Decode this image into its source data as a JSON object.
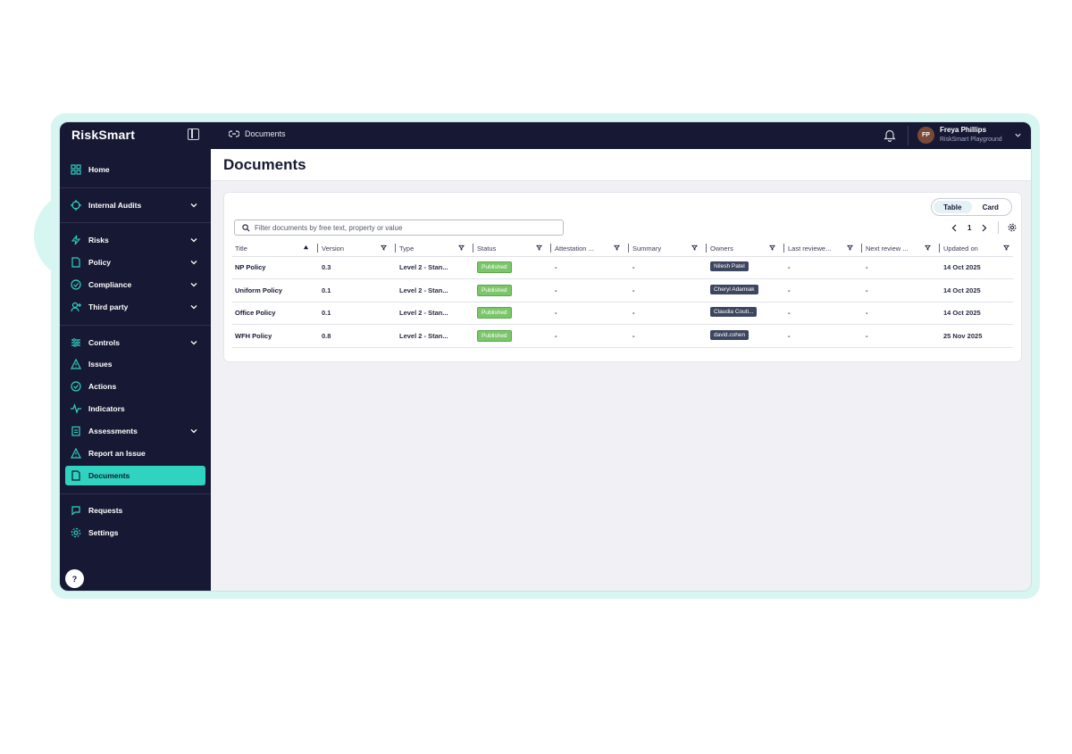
{
  "app": {
    "brand": "RiskSmart"
  },
  "breadcrumb": {
    "label": "Documents"
  },
  "user": {
    "initials": "FP",
    "name": "Freya Phillips",
    "org": "RiskSmart Playground"
  },
  "sidebar": {
    "items": [
      {
        "label": "Home",
        "icon": "grid-icon"
      },
      {
        "label": "Internal Audits",
        "icon": "audit-icon",
        "expandable": true
      },
      {
        "label": "Risks",
        "icon": "bolt-icon",
        "expandable": true
      },
      {
        "label": "Policy",
        "icon": "document-icon",
        "expandable": true
      },
      {
        "label": "Compliance",
        "icon": "check-circle-icon",
        "expandable": true
      },
      {
        "label": "Third party",
        "icon": "user-plus-icon",
        "expandable": true
      },
      {
        "label": "Controls",
        "icon": "sliders-icon",
        "expandable": true
      },
      {
        "label": "Issues",
        "icon": "warning-icon"
      },
      {
        "label": "Actions",
        "icon": "check-circle-icon"
      },
      {
        "label": "Indicators",
        "icon": "pulse-icon"
      },
      {
        "label": "Assessments",
        "icon": "clipboard-icon",
        "expandable": true
      },
      {
        "label": "Report an Issue",
        "icon": "warning-icon"
      },
      {
        "label": "Documents",
        "icon": "document-icon",
        "active": true
      },
      {
        "label": "Requests",
        "icon": "chat-icon"
      },
      {
        "label": "Settings",
        "icon": "gear-icon"
      }
    ],
    "help_label": "?"
  },
  "main": {
    "title": "Documents",
    "view_toggle": {
      "table": "Table",
      "card": "Card",
      "selected": "Table"
    },
    "search": {
      "placeholder": "Filter documents by free text, property or value"
    },
    "pager": {
      "page": "1"
    },
    "columns": [
      "Title",
      "Version",
      "Type",
      "Status",
      "Attestation ...",
      "Summary",
      "Owners",
      "Last reviewe...",
      "Next review ...",
      "Updated on"
    ],
    "rows": [
      {
        "title": "NP Policy",
        "version": "0.3",
        "type": "Level 2 - Stan...",
        "status": "Published",
        "attestation": "-",
        "summary": "-",
        "owner": "Nilesh Patel",
        "last_review": "-",
        "next_review": "-",
        "updated": "14 Oct 2025"
      },
      {
        "title": "Uniform Policy",
        "version": "0.1",
        "type": "Level 2 - Stan...",
        "status": "Published",
        "attestation": "-",
        "summary": "-",
        "owner": "Cheryl Adamiak",
        "last_review": "-",
        "next_review": "-",
        "updated": "14 Oct 2025"
      },
      {
        "title": "Office Policy",
        "version": "0.1",
        "type": "Level 2 - Stan...",
        "status": "Published",
        "attestation": "-",
        "summary": "-",
        "owner": "Claudia Couti...",
        "last_review": "-",
        "next_review": "-",
        "updated": "14 Oct 2025"
      },
      {
        "title": "WFH Policy",
        "version": "0.8",
        "type": "Level 2 - Stan...",
        "status": "Published",
        "attestation": "-",
        "summary": "-",
        "owner": "david.cohen",
        "last_review": "-",
        "next_review": "-",
        "updated": "25 Nov 2025"
      }
    ]
  },
  "colors": {
    "sidebar_bg": "#171934",
    "accent": "#2fd3c0",
    "published": "#7bc66a",
    "owner_badge": "#3d4660"
  }
}
